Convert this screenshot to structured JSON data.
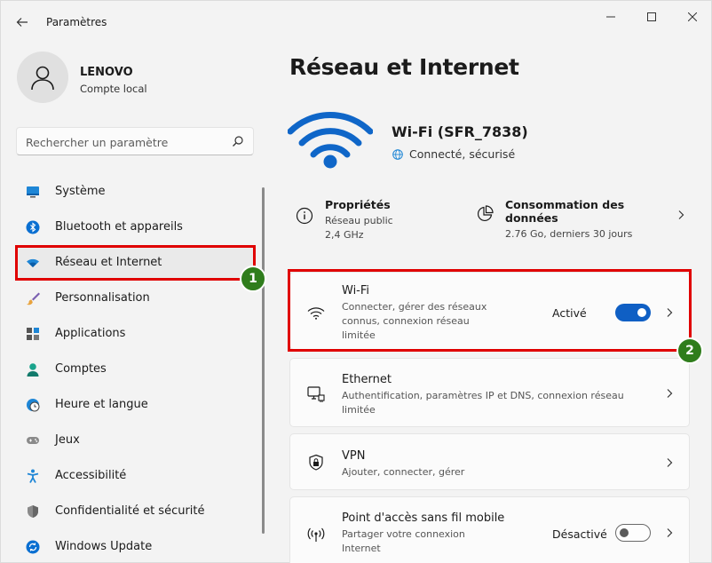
{
  "window": {
    "title": "Paramètres",
    "back_icon": "arrow-left-icon"
  },
  "profile": {
    "name": "LENOVO",
    "account_type": "Compte local"
  },
  "search": {
    "placeholder": "Rechercher un paramètre"
  },
  "sidebar": {
    "items": [
      {
        "label": "Système",
        "icon": "system-display-icon"
      },
      {
        "label": "Bluetooth et appareils",
        "icon": "bluetooth-icon"
      },
      {
        "label": "Réseau et Internet",
        "icon": "network-wifi-icon",
        "active": true
      },
      {
        "label": "Personnalisation",
        "icon": "paintbrush-icon"
      },
      {
        "label": "Applications",
        "icon": "apps-icon"
      },
      {
        "label": "Comptes",
        "icon": "person-icon"
      },
      {
        "label": "Heure et langue",
        "icon": "clock-globe-icon"
      },
      {
        "label": "Jeux",
        "icon": "gamepad-icon"
      },
      {
        "label": "Accessibilité",
        "icon": "accessibility-icon"
      },
      {
        "label": "Confidentialité et sécurité",
        "icon": "shield-icon"
      },
      {
        "label": "Windows Update",
        "icon": "update-icon"
      }
    ]
  },
  "annotations": {
    "badge_1": "1",
    "badge_2": "2",
    "highlight_color": "#e00000",
    "badge_color": "#2f7d1c"
  },
  "main": {
    "title": "Réseau et Internet",
    "network": {
      "name": "Wi-Fi (SFR_7838)",
      "status": "Connecté, sécurisé"
    },
    "properties": {
      "title": "Propriétés",
      "line1": "Réseau public",
      "line2": "2,4 GHz"
    },
    "data_usage": {
      "title": "Consommation des données",
      "sub": "2.76 Go, derniers 30 jours"
    },
    "cards": {
      "wifi": {
        "title": "Wi-Fi",
        "desc_line1": "Connecter, gérer des réseaux",
        "desc_line2": "connus, connexion réseau",
        "desc_line3": "limitée",
        "state": "Activé",
        "toggle_on": true
      },
      "ethernet": {
        "title": "Ethernet",
        "desc_line1": "Authentification, paramètres IP et DNS, connexion réseau",
        "desc_line2": "limitée"
      },
      "vpn": {
        "title": "VPN",
        "desc_line1": "Ajouter, connecter, gérer"
      },
      "hotspot": {
        "title": "Point d'accès sans fil mobile",
        "desc_line1": "Partager votre connexion",
        "desc_line2": "Internet",
        "state": "Désactivé",
        "toggle_on": false
      }
    }
  },
  "colors": {
    "accent": "#0f5fc4",
    "background": "#f3f3f3",
    "card": "#fbfbfb"
  }
}
